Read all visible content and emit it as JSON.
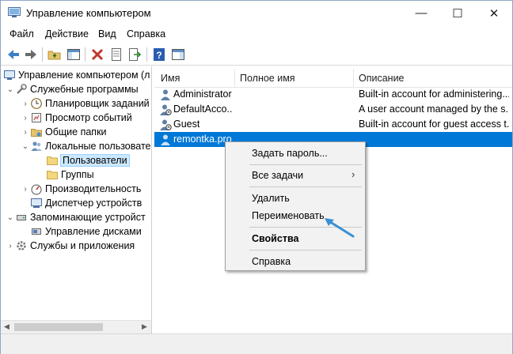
{
  "window": {
    "title": "Управление компьютером",
    "controls": {
      "minimize": "—",
      "maximize": "☐",
      "close": "✕"
    }
  },
  "menu": [
    "Файл",
    "Действие",
    "Вид",
    "Справка"
  ],
  "toolbar": {
    "buttons": [
      "back-icon",
      "forward-icon",
      "up-folder-icon",
      "show-hide-tree-icon",
      "delete-icon",
      "properties-icon",
      "export-icon",
      "help-icon",
      "show-action-pane-icon"
    ]
  },
  "tree": {
    "items": [
      {
        "label": "Управление компьютером (л",
        "icon": "computer-management-icon"
      },
      {
        "label": "Служебные программы",
        "icon": "tools-icon"
      },
      {
        "label": "Планировщик заданий",
        "icon": "clock-icon"
      },
      {
        "label": "Просмотр событий",
        "icon": "event-viewer-icon"
      },
      {
        "label": "Общие папки",
        "icon": "shared-folders-icon"
      },
      {
        "label": "Локальные пользовате",
        "icon": "users-icon"
      },
      {
        "label": "Пользователи",
        "icon": "folder-icon",
        "selected": true
      },
      {
        "label": "Группы",
        "icon": "folder-icon"
      },
      {
        "label": "Производительность",
        "icon": "performance-icon"
      },
      {
        "label": "Диспетчер устройств",
        "icon": "device-manager-icon"
      },
      {
        "label": "Запоминающие устройст",
        "icon": "storage-icon"
      },
      {
        "label": "Управление дисками",
        "icon": "disk-icon"
      },
      {
        "label": "Службы и приложения",
        "icon": "services-icon"
      }
    ]
  },
  "list": {
    "columns": [
      "Имя",
      "Полное имя",
      "Описание"
    ],
    "rows": [
      {
        "name": "Administrator",
        "full_name": "",
        "description": "Built-in account for administering..."
      },
      {
        "name": "DefaultAcco...",
        "full_name": "",
        "description": "A user account managed by the s..."
      },
      {
        "name": "Guest",
        "full_name": "",
        "description": "Built-in account for guest access t..."
      },
      {
        "name": "remontka.pro",
        "full_name": "",
        "description": "",
        "selected": true
      }
    ]
  },
  "context_menu": {
    "items": [
      {
        "label": "Задать пароль..."
      },
      {
        "label": "Все задачи",
        "submenu": "›"
      },
      {
        "label": "Удалить"
      },
      {
        "label": "Переименовать"
      },
      {
        "label": "Свойства",
        "bold": true
      },
      {
        "label": "Справка"
      }
    ]
  },
  "colors": {
    "selection": "#0078d7",
    "tree_selection": "#cce8ff",
    "annotation_arrow": "#3a8fd0"
  }
}
